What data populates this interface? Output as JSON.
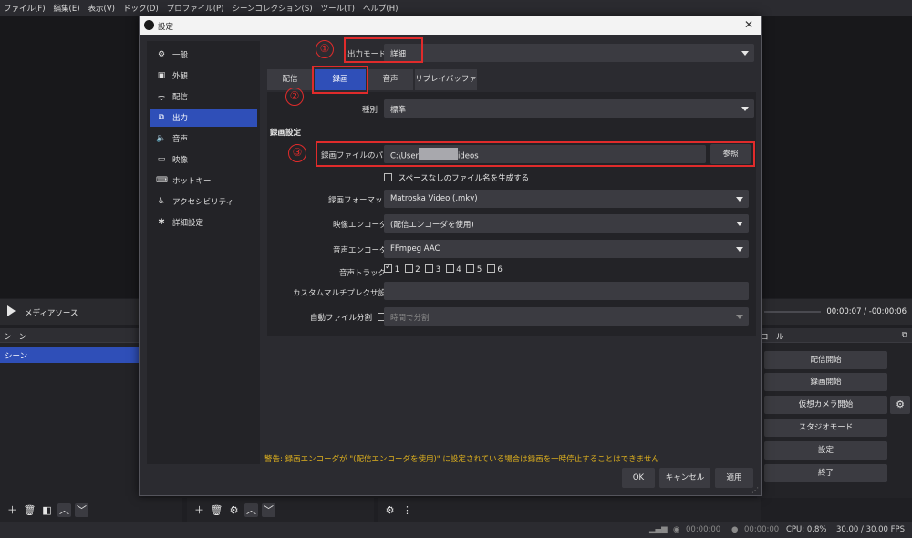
{
  "menubar": [
    "ファイル(F)",
    "編集(E)",
    "表示(V)",
    "ドック(D)",
    "プロファイル(P)",
    "シーンコレクション(S)",
    "ツール(T)",
    "ヘルプ(H)"
  ],
  "media": {
    "label": "メディアソース",
    "time": "00:00:07  /  -00:00:06"
  },
  "scenes": {
    "title": "シーン",
    "items": [
      "シーン"
    ]
  },
  "controls": {
    "title": "ロール",
    "buttons": [
      "配信開始",
      "録画開始",
      "仮想カメラ開始",
      "スタジオモード",
      "設定",
      "終了"
    ]
  },
  "status": {
    "rec_time": "00:00:00",
    "stream_time": "00:00:00",
    "cpu": "CPU: 0.8%",
    "fps": "30.00 / 30.00 FPS"
  },
  "dialog": {
    "title": "設定",
    "nav": [
      "一般",
      "外観",
      "配信",
      "出力",
      "音声",
      "映像",
      "ホットキー",
      "アクセシビリティ",
      "詳細設定"
    ],
    "output_mode_label": "出力モード",
    "output_mode_value": "詳細",
    "tabs": [
      "配信",
      "録画",
      "音声",
      "リプレイバッファ"
    ],
    "type_label": "種別",
    "type_value": "標準",
    "section_title": "録画設定",
    "path_label": "録画ファイルのパス",
    "path_value": "C:\\User",
    "path_value_tail": "ideos",
    "browse_label": "参照",
    "no_space_label": "スペースなしのファイル名を生成する",
    "format_label": "録画フォーマット",
    "format_value": "Matroska Video (.mkv)",
    "video_encoder_label": "映像エンコーダ",
    "video_encoder_value": "(配信エンコーダを使用)",
    "audio_encoder_label": "音声エンコーダ",
    "audio_encoder_value": "FFmpeg AAC",
    "audio_track_label": "音声トラック",
    "tracks": [
      "1",
      "2",
      "3",
      "4",
      "5",
      "6"
    ],
    "muxer_label": "カスタムマルチプレクサ設定",
    "auto_split_label": "自動ファイル分割",
    "auto_split_value": "時間で分割",
    "warning": "警告: 録画エンコーダが \"(配信エンコーダを使用)\" に設定されている場合は録画を一時停止することはできません",
    "ok": "OK",
    "cancel": "キャンセル",
    "apply": "適用"
  },
  "annotations": [
    "①",
    "②",
    "③"
  ],
  "colors": {
    "accent": "#2f4fb8",
    "annotation": "#e02b2b",
    "warning": "#e0b21e"
  }
}
